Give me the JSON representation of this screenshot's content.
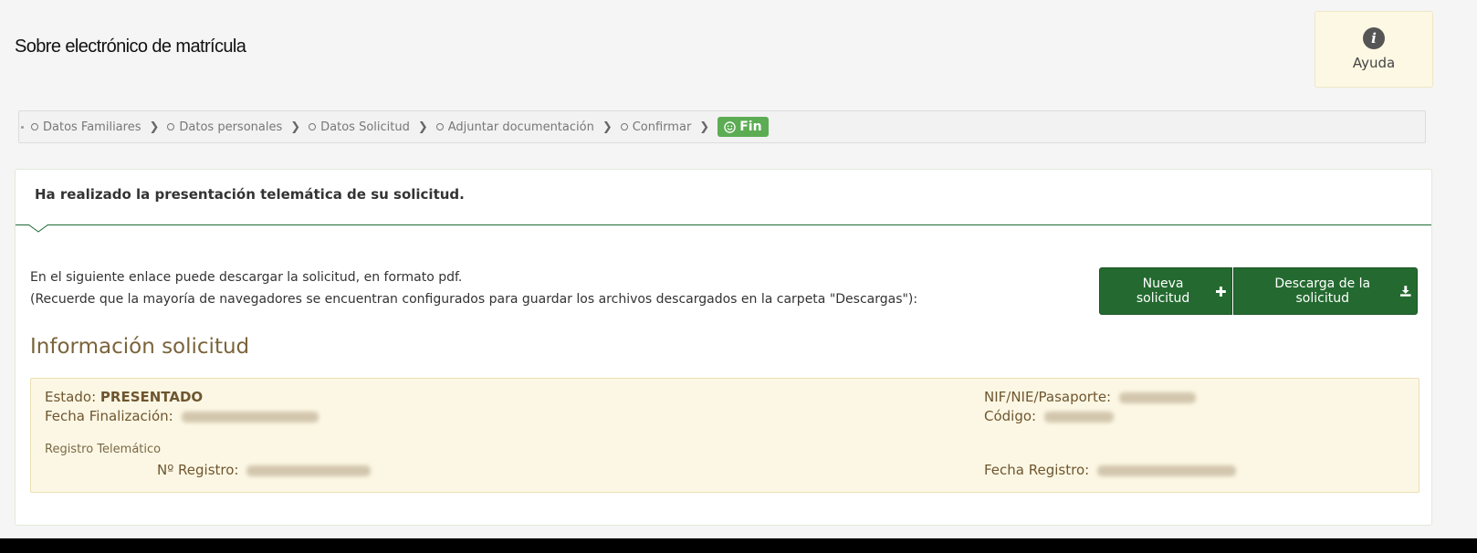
{
  "header": {
    "title": "Sobre electrónico de matrícula",
    "help_label": "Ayuda"
  },
  "breadcrumb": {
    "steps": [
      "Datos Familiares",
      "Datos personales",
      "Datos Solicitud",
      "Adjuntar documentación",
      "Confirmar"
    ],
    "final": "Fin"
  },
  "panel": {
    "heading": "Ha realizado la presentación telemática de su solicitud.",
    "intro_line1": "En el siguiente enlace puede descargar la solicitud, en formato pdf.",
    "intro_line2": "(Recuerde que la mayoría de navegadores se encuentran configurados para guardar los archivos descargados en la carpeta \"Descargas\"):",
    "new_button": "Nueva solicitud",
    "download_button": "Descarga de la solicitud"
  },
  "info": {
    "section_title": "Información solicitud",
    "estado_label": "Estado:",
    "estado_value": "PRESENTADO",
    "fecha_fin_label": "Fecha Finalización:",
    "registro_heading": "Registro Telemático",
    "num_registro_label": "Nº Registro:",
    "nif_label": "NIF/NIE/Pasaporte:",
    "codigo_label": "Código:",
    "fecha_registro_label": "Fecha Registro:"
  },
  "colors": {
    "primary_green": "#246a30",
    "success_green": "#5cac54",
    "info_background": "#fcf7e4",
    "section_title": "#7a643a"
  }
}
